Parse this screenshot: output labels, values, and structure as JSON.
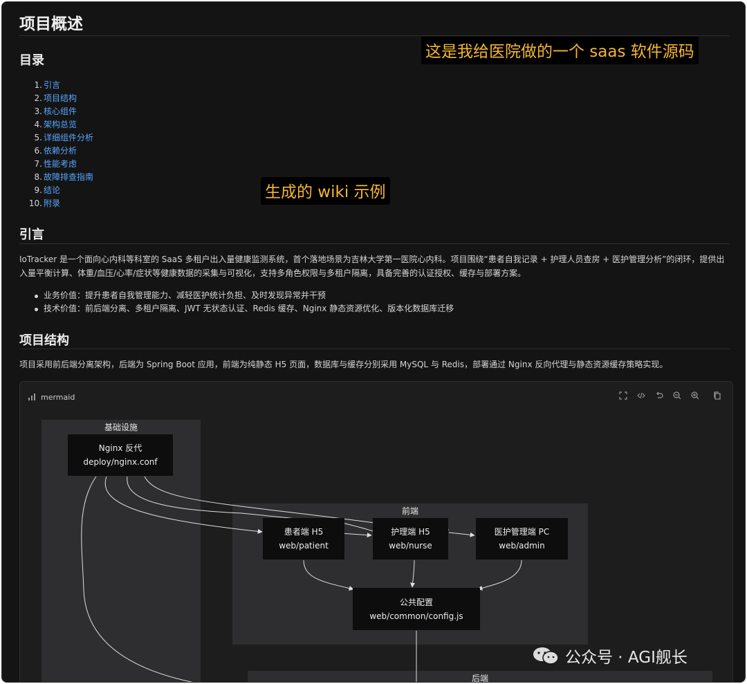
{
  "page": {
    "title": "项目概述",
    "callout_top": "这是我给医院做的一个 saas 软件源码",
    "callout_mid": "生成的 wiki 示例",
    "watermark": "公众号 · AGI舰长"
  },
  "toc": {
    "heading": "目录",
    "items": [
      {
        "num": "1.",
        "label": "引言"
      },
      {
        "num": "2.",
        "label": "项目结构"
      },
      {
        "num": "3.",
        "label": "核心组件"
      },
      {
        "num": "4.",
        "label": "架构总览"
      },
      {
        "num": "5.",
        "label": "详细组件分析"
      },
      {
        "num": "6.",
        "label": "依赖分析"
      },
      {
        "num": "7.",
        "label": "性能考虑"
      },
      {
        "num": "8.",
        "label": "故障排查指南"
      },
      {
        "num": "9.",
        "label": "结论"
      },
      {
        "num": "10.",
        "label": "附录"
      }
    ]
  },
  "intro": {
    "heading": "引言",
    "paragraph": "IoTracker 是一个面向心内科等科室的 SaaS 多租户出入量健康监测系统，首个落地场景为吉林大学第一医院心内科。项目围绕“患者自我记录 + 护理人员查房 + 医护管理分析”的闭环，提供出入量平衡计算、体重/血压/心率/症状等健康数据的采集与可视化，支持多角色权限与多租户隔离，具备完善的认证授权、缓存与部署方案。",
    "bullets": [
      "业务价值：提升患者自我管理能力、减轻医护统计负担、及时发现异常并干预",
      "技术价值：前后端分离、多租户隔离、JWT 无状态认证、Redis 缓存、Nginx 静态资源优化、版本化数据库迁移"
    ]
  },
  "structure": {
    "heading": "项目结构",
    "paragraph": "项目采用前后端分离架构，后端为 Spring Boot 应用，前端为纯静态 H5 页面，数据库与缓存分别采用 MySQL 与 Redis，部署通过 Nginx 反向代理与静态资源缓存策略实现。"
  },
  "diagram": {
    "label": "mermaid",
    "subgraphs": {
      "infra": "基础设施",
      "frontend": "前端",
      "backend": "后端"
    },
    "nodes": {
      "nginx": {
        "line1": "Nginx 反代",
        "line2": "deploy/nginx.conf"
      },
      "patient": {
        "line1": "患者端 H5",
        "line2": "web/patient"
      },
      "nurse": {
        "line1": "护理端 H5",
        "line2": "web/nurse"
      },
      "admin": {
        "line1": "医护管理端 PC",
        "line2": "web/admin"
      },
      "common": {
        "line1": "公共配置",
        "line2": "web/common/config.js"
      }
    },
    "toolbar_icons": [
      "fullscreen-icon",
      "code-icon",
      "undo-icon",
      "zoom-out-icon",
      "zoom-in-icon",
      "copy-icon"
    ]
  }
}
